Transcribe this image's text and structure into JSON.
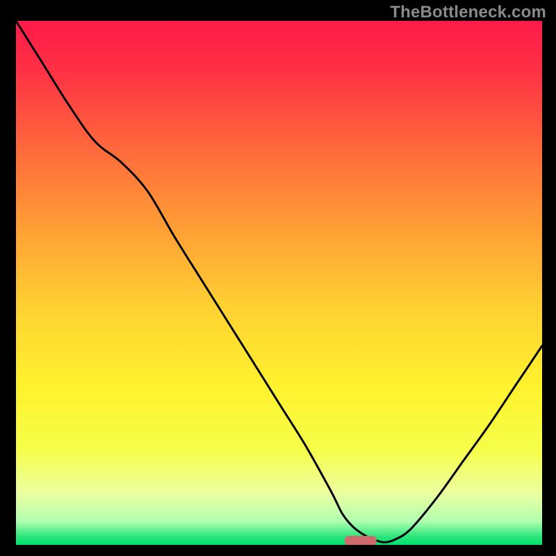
{
  "watermark": "TheBottleneck.com",
  "plot": {
    "inner_width": 757,
    "inner_height": 754,
    "inner_left": 23,
    "inner_top": 30
  },
  "gradient_stops": [
    {
      "offset": 0.0,
      "color": "#ff1a49"
    },
    {
      "offset": 0.1,
      "color": "#ff3345"
    },
    {
      "offset": 0.25,
      "color": "#ff6b3b"
    },
    {
      "offset": 0.4,
      "color": "#ffa035"
    },
    {
      "offset": 0.55,
      "color": "#ffd232"
    },
    {
      "offset": 0.7,
      "color": "#fff22e"
    },
    {
      "offset": 0.82,
      "color": "#f5ff4a"
    },
    {
      "offset": 0.9,
      "color": "#ecffa0"
    },
    {
      "offset": 0.955,
      "color": "#b1ffb0"
    },
    {
      "offset": 0.985,
      "color": "#28e57a"
    },
    {
      "offset": 1.0,
      "color": "#00e46f"
    }
  ],
  "chart_data": {
    "type": "line",
    "title": "",
    "xlabel": "",
    "ylabel": "",
    "xlim": [
      0,
      100
    ],
    "ylim": [
      0,
      100
    ],
    "x": [
      0,
      5,
      10,
      15,
      20,
      25,
      30,
      35,
      40,
      45,
      50,
      55,
      60,
      62,
      64,
      66,
      68,
      70,
      72,
      75,
      80,
      85,
      90,
      95,
      100
    ],
    "y": [
      100,
      92,
      84,
      77,
      73,
      67.5,
      59,
      51,
      43,
      35,
      27,
      19,
      10,
      6,
      3.5,
      2,
      1,
      0.5,
      1,
      3,
      9,
      16,
      23,
      30.5,
      38
    ],
    "optimal_x_range": [
      62.5,
      68.5
    ],
    "description": "Bottleneck / mismatch percentage curve: near-linear fall from top-left, reaching ~0 at x≈68, then rising roughly linearly toward the right edge."
  },
  "marker": {
    "x_center_frac": 0.655,
    "y_center_frac": 0.992,
    "width": 46,
    "height": 14,
    "color": "#cf6a6f"
  },
  "curve_color": "#000000",
  "curve_width": 3
}
